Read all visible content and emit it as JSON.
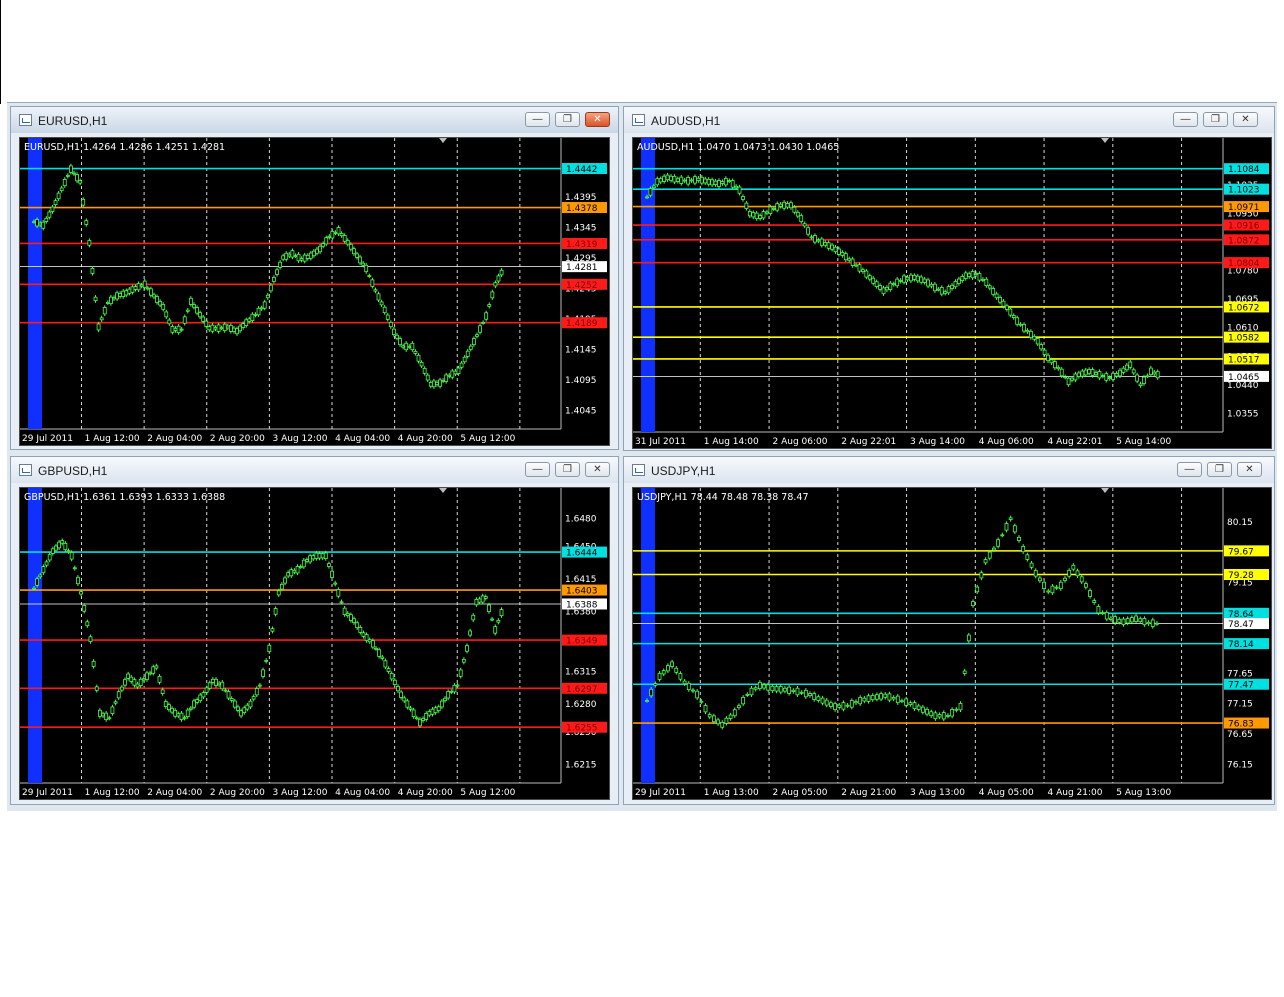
{
  "windows": [
    {
      "id": "eurusd",
      "title": "EURUSD,H1",
      "active": true,
      "header": "EURUSD,H1  1.4264 1.4286 1.4251 1.4281",
      "price_ticks": [
        "1.4395",
        "1.4345",
        "1.4295",
        "1.4245",
        "1.4195",
        "1.4145",
        "1.4095",
        "1.4045"
      ],
      "time_labels": [
        "29 Jul 2011",
        "1 Aug 12:00",
        "2 Aug 04:00",
        "2 Aug 20:00",
        "3 Aug 12:00",
        "4 Aug 04:00",
        "4 Aug 20:00",
        "5 Aug 12:00"
      ],
      "levels": [
        {
          "label": "1.4442",
          "color": "#00e0e0"
        },
        {
          "label": "1.4378",
          "color": "#ff9900"
        },
        {
          "label": "1.4319",
          "color": "#ff1a1a"
        },
        {
          "label": "1.4281",
          "color": "#ffffff"
        },
        {
          "label": "1.4252",
          "color": "#ff1a1a"
        },
        {
          "label": "1.4189",
          "color": "#ff1a1a"
        }
      ],
      "series": [
        1.4355,
        1.4349,
        1.4375,
        1.4408,
        1.4441,
        1.442,
        1.432,
        1.4182,
        1.4222,
        1.4233,
        1.4238,
        1.4246,
        1.4252,
        1.4233,
        1.4215,
        1.4178,
        1.4178,
        1.4224,
        1.4202,
        1.418,
        1.418,
        1.4182,
        1.4175,
        1.4189,
        1.4202,
        1.4218,
        1.426,
        1.4296,
        1.4302,
        1.4293,
        1.4299,
        1.431,
        1.433,
        1.434,
        1.4321,
        1.4299,
        1.4278,
        1.4242,
        1.421,
        1.4174,
        1.415,
        1.415,
        1.4121,
        1.4088,
        1.409,
        1.4102,
        1.411,
        1.4138,
        1.4168,
        1.42,
        1.4252,
        1.4281
      ]
    },
    {
      "id": "audusd",
      "title": "AUDUSD,H1",
      "active": false,
      "header": "AUDUSD,H1  1.0470 1.0473 1.0430 1.0465",
      "price_ticks": [
        "1.1035",
        "1.0950",
        "1.0865",
        "1.0780",
        "1.0695",
        "1.0610",
        "1.0525",
        "1.0440",
        "1.0355"
      ],
      "time_labels": [
        "31 Jul 2011",
        "1 Aug 14:00",
        "2 Aug 06:00",
        "2 Aug 22:01",
        "3 Aug 14:00",
        "4 Aug 06:00",
        "4 Aug 22:01",
        "5 Aug 14:00"
      ],
      "levels": [
        {
          "label": "1.1084",
          "color": "#00e0e0"
        },
        {
          "label": "1.1023",
          "color": "#00e0e0"
        },
        {
          "label": "1.0971",
          "color": "#ff9900"
        },
        {
          "label": "1.0916",
          "color": "#ff1a1a"
        },
        {
          "label": "1.0872",
          "color": "#ff1a1a"
        },
        {
          "label": "1.0804",
          "color": "#ff1a1a"
        },
        {
          "label": "1.0672",
          "color": "#ffff00"
        },
        {
          "label": "1.0582",
          "color": "#ffff00"
        },
        {
          "label": "1.0517",
          "color": "#ffff00"
        },
        {
          "label": "1.0465",
          "color": "#ffffff"
        }
      ],
      "series": [
        1.1,
        1.1045,
        1.1058,
        1.105,
        1.1048,
        1.1052,
        1.1045,
        1.104,
        1.1048,
        1.102,
        1.095,
        1.094,
        1.096,
        1.0975,
        1.0975,
        1.0935,
        1.088,
        1.0865,
        1.085,
        1.083,
        1.0805,
        1.078,
        1.075,
        1.072,
        1.074,
        1.0755,
        1.076,
        1.075,
        1.073,
        1.0715,
        1.074,
        1.0765,
        1.077,
        1.0745,
        1.0705,
        1.067,
        1.063,
        1.06,
        1.057,
        1.052,
        1.049,
        1.045,
        1.047,
        1.048,
        1.047,
        1.046,
        1.0475,
        1.05,
        1.044,
        1.048,
        1.0465
      ]
    },
    {
      "id": "gbpusd",
      "title": "GBPUSD,H1",
      "active": false,
      "header": "GBPUSD,H1  1.6361 1.6393 1.6333 1.6388",
      "price_ticks": [
        "1.6480",
        "1.6450",
        "1.6415",
        "1.6380",
        "1.6350",
        "1.6315",
        "1.6280",
        "1.6250",
        "1.6215"
      ],
      "time_labels": [
        "29 Jul 2011",
        "1 Aug 12:00",
        "2 Aug 04:00",
        "2 Aug 20:00",
        "3 Aug 12:00",
        "4 Aug 04:00",
        "4 Aug 20:00",
        "5 Aug 12:00"
      ],
      "levels": [
        {
          "label": "1.6444",
          "color": "#00e0e0"
        },
        {
          "label": "1.6403",
          "color": "#ff9900"
        },
        {
          "label": "1.6388",
          "color": "#ffffff"
        },
        {
          "label": "1.6349",
          "color": "#ff1a1a"
        },
        {
          "label": "1.6297",
          "color": "#ff1a1a"
        },
        {
          "label": "1.6255",
          "color": "#ff1a1a"
        }
      ],
      "series": [
        1.6405,
        1.6425,
        1.6445,
        1.6455,
        1.644,
        1.64,
        1.635,
        1.627,
        1.6265,
        1.629,
        1.631,
        1.63,
        1.631,
        1.632,
        1.628,
        1.627,
        1.6265,
        1.628,
        1.629,
        1.6305,
        1.63,
        1.6285,
        1.627,
        1.628,
        1.63,
        1.634,
        1.64,
        1.642,
        1.6425,
        1.6435,
        1.644,
        1.644,
        1.641,
        1.638,
        1.637,
        1.6355,
        1.6345,
        1.633,
        1.631,
        1.629,
        1.6275,
        1.626,
        1.627,
        1.6275,
        1.629,
        1.63,
        1.634,
        1.639,
        1.6395,
        1.636,
        1.6388
      ]
    },
    {
      "id": "usdjpy",
      "title": "USDJPY,H1",
      "active": false,
      "header": "USDJPY,H1  78.44 78.48 78.38 78.47",
      "price_ticks": [
        "80.15",
        "79.65",
        "79.15",
        "78.65",
        "78.15",
        "77.65",
        "77.15",
        "76.65",
        "76.15"
      ],
      "time_labels": [
        "29 Jul 2011",
        "1 Aug 13:00",
        "2 Aug 05:00",
        "2 Aug 21:00",
        "3 Aug 13:00",
        "4 Aug 05:00",
        "4 Aug 21:00",
        "5 Aug 13:00"
      ],
      "levels": [
        {
          "label": "79.67",
          "color": "#ffff00"
        },
        {
          "label": "79.28",
          "color": "#ffff00"
        },
        {
          "label": "78.64",
          "color": "#00e0e0"
        },
        {
          "label": "78.47",
          "color": "#ffffff"
        },
        {
          "label": "78.14",
          "color": "#00e0e0"
        },
        {
          "label": "77.47",
          "color": "#00e0e0"
        },
        {
          "label": "76.83",
          "color": "#ff9900"
        }
      ],
      "series": [
        77.2,
        77.6,
        77.8,
        77.5,
        77.3,
        76.95,
        76.8,
        77.0,
        77.3,
        77.45,
        77.4,
        77.38,
        77.35,
        77.3,
        77.2,
        77.1,
        77.12,
        77.2,
        77.25,
        77.28,
        77.22,
        77.15,
        77.05,
        76.95,
        76.95,
        77.1,
        78.8,
        79.5,
        79.8,
        80.2,
        79.7,
        79.3,
        79.0,
        79.1,
        79.4,
        79.1,
        78.7,
        78.55,
        78.5,
        78.55,
        78.48,
        78.47
      ]
    }
  ]
}
